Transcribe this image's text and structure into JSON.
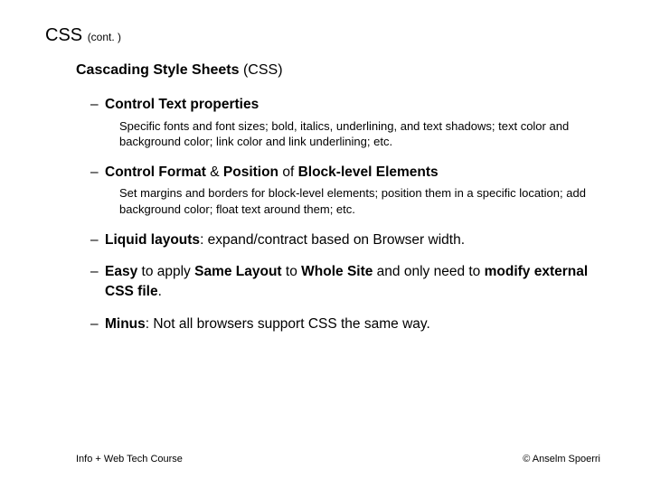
{
  "title": {
    "main": "CSS",
    "suffix": "(cont. )"
  },
  "subtitle": {
    "bold": "Cascading Style Sheets",
    "rest": " (CSS)"
  },
  "bullets": [
    {
      "head_parts": [
        {
          "t": "Control Text properties",
          "b": true
        }
      ],
      "desc": "Specific fonts and font sizes; bold, italics, underlining, and text shadows; text color and background color; link color and link underlining; etc."
    },
    {
      "head_parts": [
        {
          "t": "Control Format",
          "b": true
        },
        {
          "t": " & ",
          "b": false
        },
        {
          "t": "Position",
          "b": true
        },
        {
          "t": " of ",
          "b": false
        },
        {
          "t": "Block-level Elements",
          "b": true
        }
      ],
      "desc": "Set margins and borders for block-level elements; position them in a specific location; add background color; float text around them; etc."
    },
    {
      "head_parts": [
        {
          "t": "Liquid layouts",
          "b": true
        },
        {
          "t": ": expand/contract based on Browser width.",
          "b": false
        }
      ]
    },
    {
      "head_parts": [
        {
          "t": "Easy",
          "b": true
        },
        {
          "t": " to apply ",
          "b": false
        },
        {
          "t": "Same Layout",
          "b": true
        },
        {
          "t": " to ",
          "b": false
        },
        {
          "t": "Whole Site",
          "b": true
        },
        {
          "t": " and only need to ",
          "b": false
        },
        {
          "t": "modify external CSS file",
          "b": true
        },
        {
          "t": ".",
          "b": false
        }
      ]
    },
    {
      "head_parts": [
        {
          "t": "Minus",
          "b": true
        },
        {
          "t": ": Not all browsers support CSS the same way.",
          "b": false
        }
      ]
    }
  ],
  "footer": {
    "left": "Info + Web Tech Course",
    "right": "© Anselm Spoerri"
  }
}
